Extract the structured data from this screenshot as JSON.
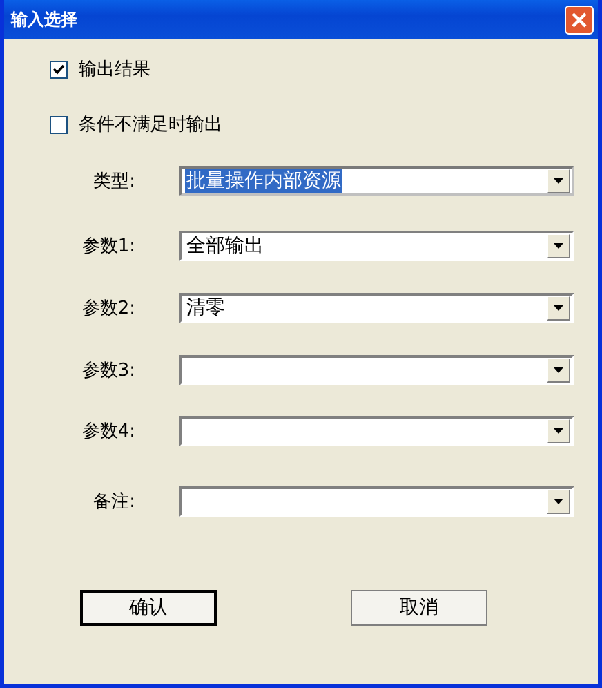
{
  "window": {
    "title": "输入选择"
  },
  "checkboxes": [
    {
      "label": "输出结果",
      "checked": true
    },
    {
      "label": "条件不满足时输出",
      "checked": false
    }
  ],
  "fields": [
    {
      "label": "类型:",
      "value": "批量操作内部资源",
      "text_selected": true
    },
    {
      "label": "参数1:",
      "value": "全部输出",
      "text_selected": false
    },
    {
      "label": "参数2:",
      "value": "清零",
      "text_selected": false
    },
    {
      "label": "参数3:",
      "text_selected": false
    },
    {
      "label": "参数4:",
      "text_selected": false
    },
    {
      "label": "备注:",
      "text_selected": false
    }
  ],
  "buttons": [
    {
      "label": "确认",
      "default": true
    },
    {
      "label": "取消",
      "default": false
    }
  ]
}
